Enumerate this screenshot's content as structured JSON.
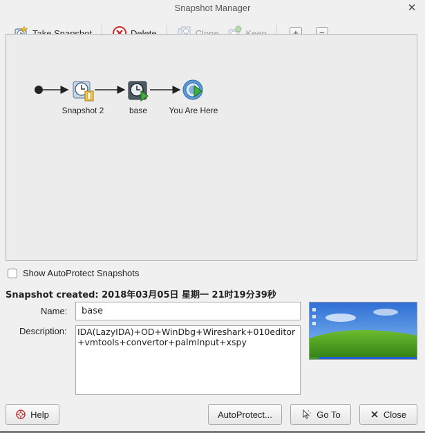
{
  "window": {
    "title": "Snapshot Manager",
    "close_glyph": "✕"
  },
  "toolbar": {
    "take_snapshot": "Take Snapshot",
    "delete": "Delete",
    "clone": "Clone",
    "keep": "Keep",
    "expand_glyph": "+",
    "collapse_glyph": "−"
  },
  "snapshots": [
    {
      "label": "Snapshot 2",
      "icon": "snapshot-clock-icon"
    },
    {
      "label": "base",
      "icon": "snapshot-base-icon"
    },
    {
      "label": "You Are Here",
      "icon": "current-state-icon"
    }
  ],
  "show_autoprotect": {
    "label": "Show AutoProtect Snapshots",
    "checked": false
  },
  "details": {
    "created": "Snapshot created: 2018年03月05日 星期一 21时19分39秒",
    "name_label": "Name:",
    "name_value": "base",
    "description_label": "Description:",
    "description_value": "IDA(LazyIDA)+OD+WinDbg+Wireshark+010editor\n+vmtools+convertor+palmInput+xspy"
  },
  "buttons": {
    "help": "Help",
    "autoprotect": "AutoProtect...",
    "goto": "Go To",
    "close": "Close"
  },
  "colors": {
    "accent_blue": "#2f7fc4",
    "delete_red": "#d22a2a",
    "disabled": "#9a9a9a"
  }
}
